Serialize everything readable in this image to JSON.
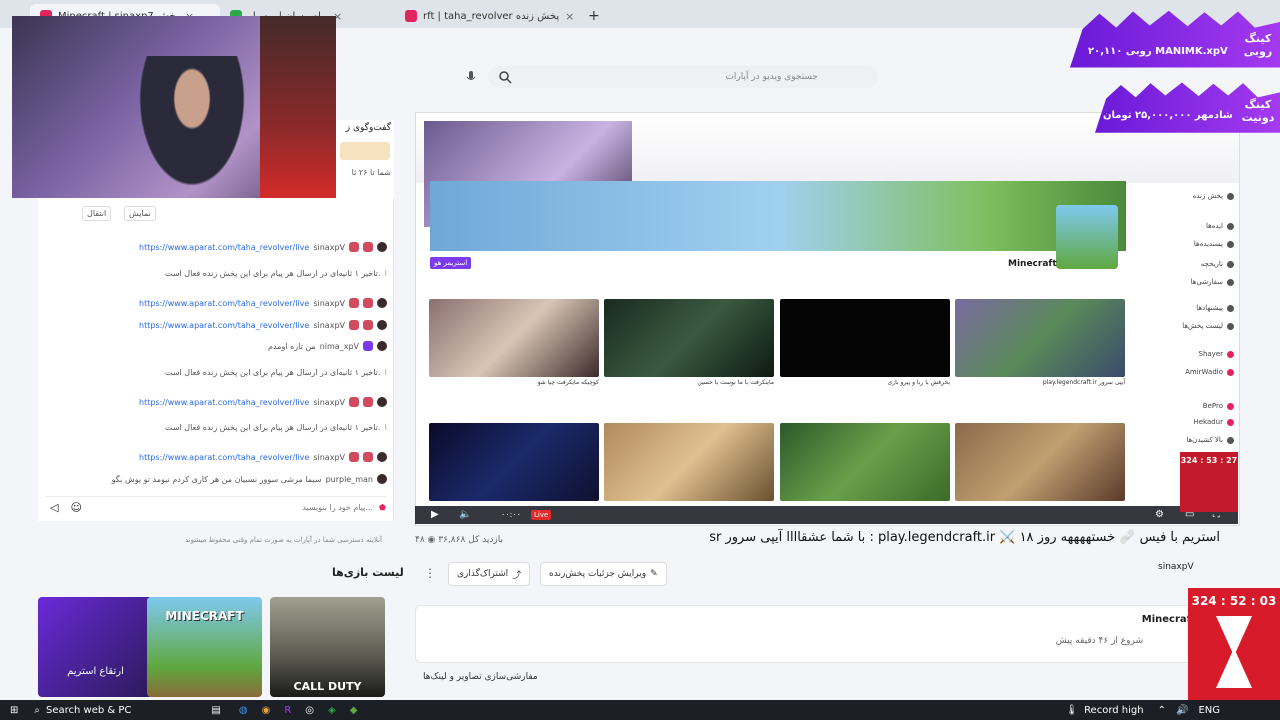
{
  "tabs": [
    {
      "label": "Minecraft | sinaxp7 پخش",
      "close": "×"
    },
    {
      "label": "پیام رسان | ویسپار",
      "close": "×"
    },
    {
      "label": "rft | taha_revolver پخش زنده",
      "close": "×"
    },
    {
      "label": "+"
    }
  ],
  "search": {
    "placeholder": "جستجوی ویدیو در آپارات"
  },
  "chat": {
    "header": "گفت‌وگوی ز",
    "subtitle": "شما تا ۲۶ ثا",
    "filter_buttons": [
      "انتقال",
      "نمایش"
    ],
    "messages": [
      {
        "type": "link",
        "text": "https://www.aparat.com/taha_revolver/live",
        "user": "sinaxpV"
      },
      {
        "type": "warn",
        "text": "تاخیر ۱ ثانیه‌ای در ارسال هر پیام برای این پخش زنده فعال است."
      },
      {
        "type": "link",
        "text": "https://www.aparat.com/taha_revolver/live",
        "user": "sinaxpV"
      },
      {
        "type": "link",
        "text": "https://www.aparat.com/taha_revolver/live",
        "user": "sinaxpV"
      },
      {
        "type": "msg",
        "text": "من تازه اومدم",
        "user": "nima_xpV"
      },
      {
        "type": "warn",
        "text": "تاخیر ۱ ثانیه‌ای در ارسال هر پیام برای این پخش زنده فعال است."
      },
      {
        "type": "link",
        "text": "https://www.aparat.com/taha_revolver/live",
        "user": "sinaxpV"
      },
      {
        "type": "warn",
        "text": "تاخیر ۱ ثانیه‌ای در ارسال هر پیام برای این پخش زنده فعال است."
      },
      {
        "type": "link",
        "text": "https://www.aparat.com/taha_revolver/live",
        "user": "sinaxpV"
      },
      {
        "type": "msg",
        "text": "سیما مرشی سوور نسبیان من هر کاری کردم نیومد تو یوش بگو",
        "user": "purple_man"
      }
    ],
    "input_placeholder": "پیام خود را بنویسید...",
    "footer_note": "آنلاینه دسترسی شما در آپارات به صورت تمام وقتی محفوظ میشوند"
  },
  "player": {
    "game_label": "Minecraft",
    "streamer_tag": "استریمر هو",
    "live_label": "Live",
    "time": "۰۰:۰۰",
    "thumbs": [
      {
        "caption": "کوچیکه مایکرفت چیا شو"
      },
      {
        "caption": "ماینکرفت با ما نوست با حسین"
      },
      {
        "caption": "بخرفش با ربا و پیرو بازی"
      },
      {
        "caption": "play.legendcraft.ir آیپی سرور"
      }
    ]
  },
  "stream": {
    "title": "sr با شما عشقاااا آیپی سرور : play.legendcraft.ir ⚔️ استریم با فیس 🩹 خستههههه روز ۱۸",
    "viewers": "۳۶,۸۶۸",
    "viewers_label": "بازدید کل",
    "likes": "۴۸",
    "edit_button": "ویرایش جزئیات پخش‌زنده",
    "share_button": "اشتراک‌گذاری",
    "more": "⋮",
    "game": "Minecraf",
    "started": "شروع از ۴۶ دقیقه پیش",
    "channel": "sinaxpV",
    "customize": "مفارشی‌سازی تصاویر و لینک‌ها"
  },
  "games": {
    "title": "لیست بازی‌ها",
    "items": [
      "ارتقاع استریم",
      "MINECRAFT",
      "CALL DUTY"
    ]
  },
  "donation_alerts": [
    {
      "label": "کینگ روبی",
      "text": "۲۰,۱۱۰ روبی MANIMK.xpV"
    },
    {
      "label": "کینگ دونیت",
      "text": "شادمهر ۲۵,۰۰۰,۰۰۰ تومان"
    }
  ],
  "sidebar_right": [
    "پخش زنده",
    "ایده‌ها",
    "پسندیده‌ها",
    "تاریخچه",
    "سفارشی‌ها",
    "پیشنهادها",
    "لیست پخش‌ها",
    "Shayer",
    "AmirWadio",
    "BePro",
    "Hekadur",
    "بالا کشیدن‌ها"
  ],
  "timer": {
    "small": "324 : 53 : 27",
    "large": "324 : 52 : 03"
  },
  "taskbar": {
    "search": "Search web & PC",
    "record": "Record high",
    "lang": "ENG"
  },
  "colors": {
    "accent": "#e0245e",
    "link": "#2b6be2",
    "purple": "#7c3aed",
    "alert_red": "#d81b2b"
  }
}
